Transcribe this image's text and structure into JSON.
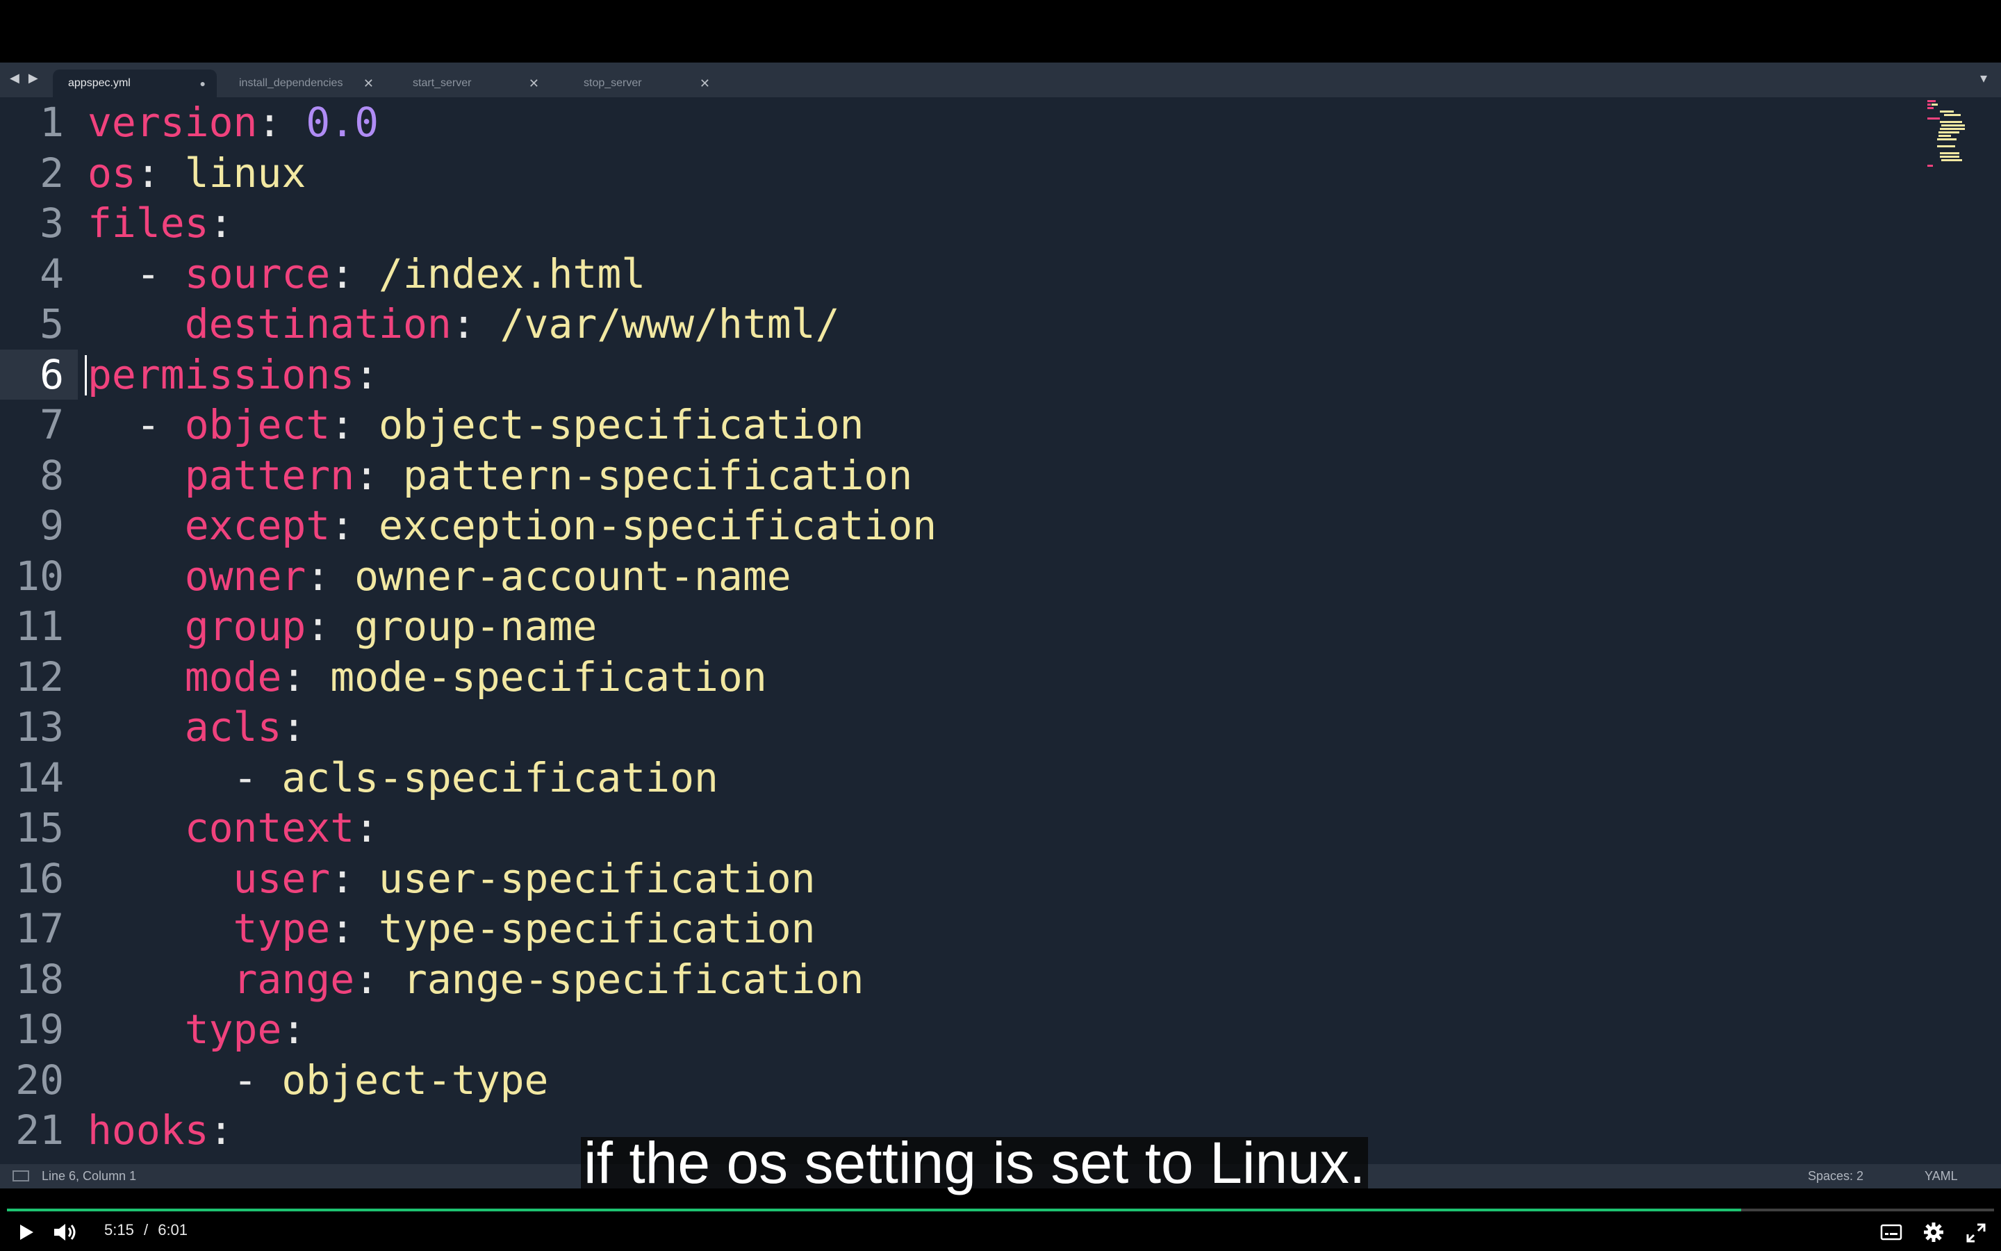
{
  "tabs": [
    {
      "label": "appspec.yml",
      "close": "●",
      "active": true
    },
    {
      "label": "install_dependencies",
      "close": "✕",
      "active": false
    },
    {
      "label": "start_server",
      "close": "✕",
      "active": false
    },
    {
      "label": "stop_server",
      "close": "✕",
      "active": false
    }
  ],
  "tab_nav_icons": "◀ ▶",
  "tab_menu_icon": "▾",
  "code": {
    "current_line": 6,
    "lines": [
      {
        "n": "1",
        "parts": [
          [
            "k",
            "version"
          ],
          [
            "p",
            ": "
          ],
          [
            "n",
            "0.0"
          ]
        ]
      },
      {
        "n": "2",
        "parts": [
          [
            "k",
            "os"
          ],
          [
            "p",
            ": "
          ],
          [
            "v",
            "linux"
          ]
        ]
      },
      {
        "n": "3",
        "parts": [
          [
            "k",
            "files"
          ],
          [
            "p",
            ":"
          ]
        ]
      },
      {
        "n": "4",
        "parts": [
          [
            "p",
            "  - "
          ],
          [
            "k",
            "source"
          ],
          [
            "p",
            ": "
          ],
          [
            "v",
            "/index.html"
          ]
        ]
      },
      {
        "n": "5",
        "parts": [
          [
            "p",
            "    "
          ],
          [
            "k",
            "destination"
          ],
          [
            "p",
            ": "
          ],
          [
            "v",
            "/var/www/html/"
          ]
        ]
      },
      {
        "n": "6",
        "parts": [
          [
            "k",
            "permissions"
          ],
          [
            "p",
            ":"
          ]
        ]
      },
      {
        "n": "7",
        "parts": [
          [
            "p",
            "  - "
          ],
          [
            "k",
            "object"
          ],
          [
            "p",
            ": "
          ],
          [
            "v",
            "object-specification"
          ]
        ]
      },
      {
        "n": "8",
        "parts": [
          [
            "p",
            "    "
          ],
          [
            "k",
            "pattern"
          ],
          [
            "p",
            ": "
          ],
          [
            "v",
            "pattern-specification"
          ]
        ]
      },
      {
        "n": "9",
        "parts": [
          [
            "p",
            "    "
          ],
          [
            "k",
            "except"
          ],
          [
            "p",
            ": "
          ],
          [
            "v",
            "exception-specification"
          ]
        ]
      },
      {
        "n": "10",
        "parts": [
          [
            "p",
            "    "
          ],
          [
            "k",
            "owner"
          ],
          [
            "p",
            ": "
          ],
          [
            "v",
            "owner-account-name"
          ]
        ]
      },
      {
        "n": "11",
        "parts": [
          [
            "p",
            "    "
          ],
          [
            "k",
            "group"
          ],
          [
            "p",
            ": "
          ],
          [
            "v",
            "group-name"
          ]
        ]
      },
      {
        "n": "12",
        "parts": [
          [
            "p",
            "    "
          ],
          [
            "k",
            "mode"
          ],
          [
            "p",
            ": "
          ],
          [
            "v",
            "mode-specification"
          ]
        ]
      },
      {
        "n": "13",
        "parts": [
          [
            "p",
            "    "
          ],
          [
            "k",
            "acls"
          ],
          [
            "p",
            ":"
          ]
        ]
      },
      {
        "n": "14",
        "parts": [
          [
            "p",
            "      - "
          ],
          [
            "v",
            "acls-specification"
          ]
        ]
      },
      {
        "n": "15",
        "parts": [
          [
            "p",
            "    "
          ],
          [
            "k",
            "context"
          ],
          [
            "p",
            ":"
          ]
        ]
      },
      {
        "n": "16",
        "parts": [
          [
            "p",
            "      "
          ],
          [
            "k",
            "user"
          ],
          [
            "p",
            ": "
          ],
          [
            "v",
            "user-specification"
          ]
        ]
      },
      {
        "n": "17",
        "parts": [
          [
            "p",
            "      "
          ],
          [
            "k",
            "type"
          ],
          [
            "p",
            ": "
          ],
          [
            "v",
            "type-specification"
          ]
        ]
      },
      {
        "n": "18",
        "parts": [
          [
            "p",
            "      "
          ],
          [
            "k",
            "range"
          ],
          [
            "p",
            ": "
          ],
          [
            "v",
            "range-specification"
          ]
        ]
      },
      {
        "n": "19",
        "parts": [
          [
            "p",
            "    "
          ],
          [
            "k",
            "type"
          ],
          [
            "p",
            ":"
          ]
        ]
      },
      {
        "n": "20",
        "parts": [
          [
            "p",
            "      - "
          ],
          [
            "v",
            "object-type"
          ]
        ]
      },
      {
        "n": "21",
        "parts": [
          [
            "k",
            "hooks"
          ],
          [
            "p",
            ":"
          ]
        ]
      }
    ]
  },
  "status": {
    "position": "Line 6, Column 1",
    "spaces": "Spaces: 2",
    "syntax": "YAML"
  },
  "caption": "if the os setting is set to Linux.",
  "player": {
    "current_time": "5:15",
    "separator": "/",
    "duration": "6:01",
    "progress_fraction": 0.8726
  },
  "colors": {
    "keyword": "#f0427d",
    "string": "#f2e8a2",
    "number": "#b08cf5",
    "progress": "#1ec271"
  }
}
